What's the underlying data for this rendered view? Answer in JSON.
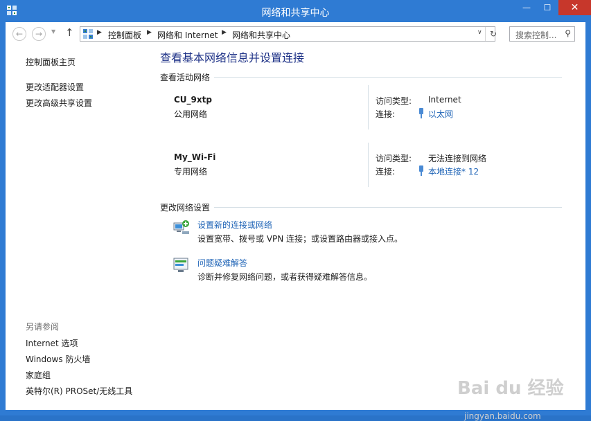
{
  "window": {
    "title": "网络和共享中心",
    "minimize": "—",
    "maximize": "☐",
    "close": "✕"
  },
  "nav": {
    "back": "←",
    "forward": "→",
    "recent": "▼",
    "up": "↑",
    "breadcrumbs": [
      "控制面板",
      "网络和 Internet",
      "网络和共享中心"
    ],
    "separator": "▶",
    "dropdown": "∨",
    "refresh": "↻",
    "search_placeholder": "搜索控制...",
    "search_icon": "⚲"
  },
  "sidebar": {
    "home": "控制面板主页",
    "links": [
      "更改适配器设置",
      "更改高级共享设置"
    ],
    "see_also_caption": "另请参阅",
    "see_also": [
      "Internet 选项",
      "Windows 防火墙",
      "家庭组",
      "英特尔(R) PROSet/无线工具"
    ]
  },
  "main": {
    "title": "查看基本网络信息并设置连接",
    "active_section": "查看活动网络",
    "networks": [
      {
        "name": "CU_9xtp",
        "category": "公用网络",
        "access_label": "访问类型:",
        "access_value": "Internet",
        "conn_label": "连接:",
        "conn_value": "以太网"
      },
      {
        "name": "My_Wi-Fi",
        "category": "专用网络",
        "access_label": "访问类型:",
        "access_value": "无法连接到网络",
        "conn_label": "连接:",
        "conn_value": "本地连接* 12"
      }
    ],
    "change_section": "更改网络设置",
    "tasks": [
      {
        "link": "设置新的连接或网络",
        "desc": "设置宽带、拨号或 VPN 连接；或设置路由器或接入点。",
        "icon": "network-setup-icon"
      },
      {
        "link": "问题疑难解答",
        "desc": "诊断并修复网络问题，或者获得疑难解答信息。",
        "icon": "troubleshoot-icon"
      }
    ]
  },
  "watermark": {
    "logo": "Bai du 经验",
    "url": "jingyan.baidu.com"
  },
  "colors": {
    "titlebar": "#2f7bd3",
    "link": "#1e63b6",
    "heading": "#1e3287",
    "close": "#c7372b"
  }
}
